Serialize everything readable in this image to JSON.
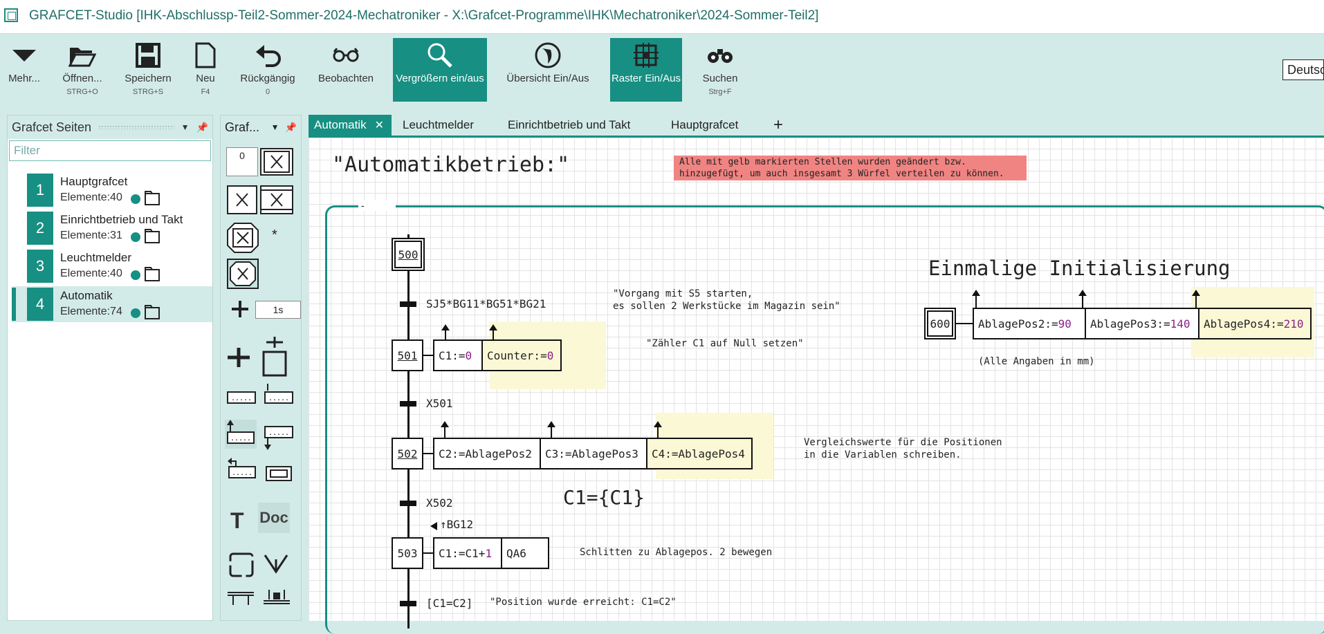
{
  "title": "GRAFCET-Studio [IHK-Abschlussp-Teil2-Sommer-2024-Mechatroniker - X:\\Grafcet-Programme\\IHK\\Mechatroniker\\2024-Sommer-Teil2]",
  "ribbon": {
    "more": "Mehr...",
    "open": "Öffnen...",
    "open_sc": "STRG+O",
    "save": "Speichern",
    "save_sc": "STRG+S",
    "new": "Neu",
    "new_sc": "F4",
    "undo": "Rückgängig",
    "undo_sc": "0",
    "observe": "Beobachten",
    "zoom": "Vergrößern ein/aus",
    "overview": "Übersicht Ein/Aus",
    "grid": "Raster Ein/Aus",
    "search": "Suchen",
    "search_sc": "Strg+F",
    "language": "Deutsch"
  },
  "pages_panel": {
    "title": "Grafcet Seiten",
    "filter_placeholder": "Filter",
    "pages": [
      {
        "num": "1",
        "name": "Hauptgrafcet",
        "elements": "Elemente:40"
      },
      {
        "num": "2",
        "name": "Einrichtbetrieb und Takt",
        "elements": "Elemente:31"
      },
      {
        "num": "3",
        "name": "Leuchtmelder",
        "elements": "Elemente:40"
      },
      {
        "num": "4",
        "name": "Automatik",
        "elements": "Elemente:74"
      }
    ]
  },
  "tools_panel": {
    "title": "Graf...",
    "num_value": "0",
    "time_value": "1s",
    "star": "*",
    "text_tool": "T",
    "doc_tool": "Doc"
  },
  "tabs": [
    "Automatik",
    "Leuchtmelder",
    "Einrichtbetrieb und Takt",
    "Hauptgrafcet"
  ],
  "tab_close": "✕",
  "tab_add": "+",
  "diagram": {
    "heading": "\"Automatikbetrieb:\"",
    "note": "Alle mit gelb markierten Stellen wurden geändert bzw.\nhinzugefügt, um auch insgesamt 3 Würfel verteilen zu können.",
    "frame_label": "-",
    "steps": {
      "s500": "500",
      "s501": "501",
      "s502": "502",
      "s503": "503",
      "s600": "600"
    },
    "transitions": {
      "t1": "SJ5*BG11*BG51*BG21",
      "t2": "X501",
      "t3": "X502",
      "t4": "[C1=C2]"
    },
    "actions": {
      "a501_1_pre": "C1:=",
      "a501_1_val": "0",
      "a501_2_pre": "Counter:=",
      "a501_2_val": "0",
      "a502_1": "C2:=AblagePos2",
      "a502_2": "C3:=AblagePos3",
      "a502_3": "C4:=AblagePos4",
      "a503_1_pre": "C1:=C1+",
      "a503_1_val": "1",
      "a503_2": "QA6",
      "a600_1_pre": "AblagePos2:=",
      "a600_1_val": "90",
      "a600_2_pre": "AblagePos3:=",
      "a600_2_val": "140",
      "a600_3_pre": "AblagePos4:=",
      "a600_3_val": "210"
    },
    "comments": {
      "c1": "\"Vorgang mit S5 starten,\nes sollen 2 Werkstücke im Magazin sein\"",
      "c2": "\"Zähler C1 auf Null setzen\"",
      "c3": "Vergleichswerte für die Positionen\nin die Variablen schreiben.",
      "c4": "Schlitten zu Ablagepos. 2 bewegen",
      "c5": "\"Position wurde erreicht: C1=C2\"",
      "init_title": "Einmalige Initialisierung",
      "init_note": "(Alle Angaben in mm)",
      "c1_expr": "C1={C1}",
      "event": "↑BG12"
    }
  }
}
